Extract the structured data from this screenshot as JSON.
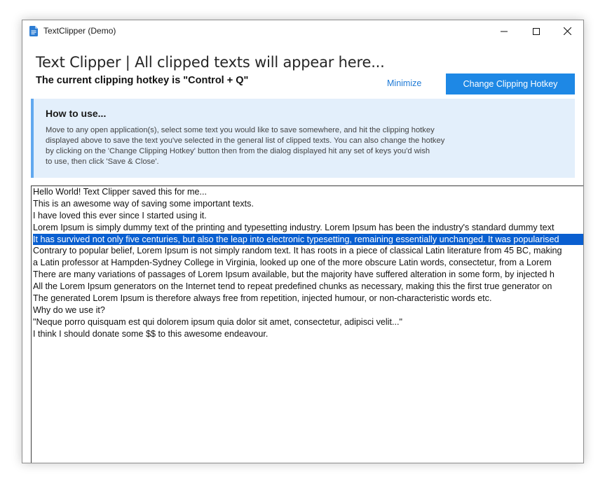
{
  "window": {
    "title": "TextClipper (Demo)"
  },
  "header": {
    "heading": "Text Clipper | All clipped texts will appear here...",
    "hotkey_text": "The current clipping hotkey is \"Control + Q\"",
    "minimize_label": "Minimize",
    "change_hotkey_label": "Change Clipping Hotkey"
  },
  "howto": {
    "title": "How to use...",
    "lines": [
      "Move to any open application(s), select some text you would like to save somewhere, and hit the clipping hotkey",
      "displayed above to save the text you've selected in the general list of clipped texts. You can also change the hotkey",
      "by clicking on the 'Change Clipping Hotkey' button then from the dialog displayed hit any set of keys you'd wish",
      "to use, then click 'Save & Close'."
    ]
  },
  "clips": {
    "selected_index": 4,
    "items": [
      "Hello World! Text Clipper saved this for me...",
      "This is an awesome way of saving some important texts.",
      "I have loved this ever since I started using it.",
      "Lorem Ipsum is simply dummy text of the printing and typesetting industry. Lorem Ipsum has been the industry's standard dummy text",
      "It has survived not only five centuries, but also the leap into electronic typesetting, remaining essentially unchanged. It was popularised",
      "Contrary to popular belief, Lorem Ipsum is not simply random text. It has roots in a piece of classical Latin literature from 45 BC, making",
      "a Latin professor at Hampden-Sydney College in Virginia, looked up one of the more obscure Latin words, consectetur, from a Lorem",
      "There are many variations of passages of Lorem Ipsum available, but the majority have suffered alteration in some form, by injected h",
      "All the Lorem Ipsum generators on the Internet tend to repeat predefined chunks as necessary, making this the first true generator on",
      "The generated Lorem Ipsum is therefore always free from repetition, injected humour, or non-characteristic words etc.",
      "Why do we use it?",
      "\"Neque porro quisquam est qui dolorem ipsum quia dolor sit amet, consectetur, adipisci velit...\"",
      "I think I should donate some $$ to this awesome endeavour."
    ]
  },
  "colors": {
    "accent": "#1e88e5",
    "link": "#1e7ad6",
    "howto_bg": "#e3effb",
    "howto_border": "#61a8ef",
    "selection": "#0a5fd0"
  },
  "icons": {
    "app": "document-icon",
    "minimize": "window-minimize-icon",
    "maximize": "window-maximize-icon",
    "close": "window-close-icon"
  }
}
